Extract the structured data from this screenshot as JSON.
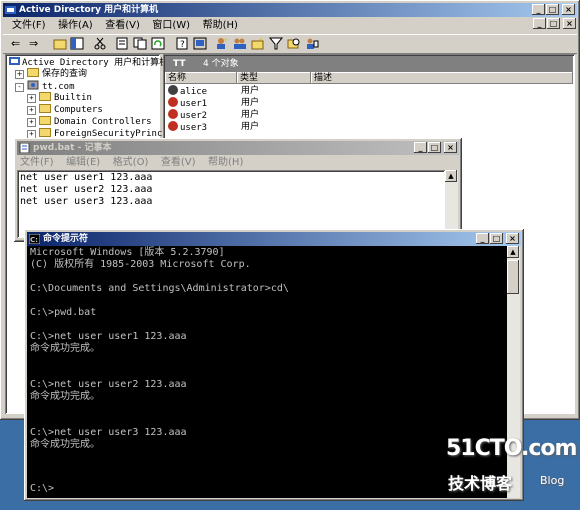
{
  "ad_window": {
    "title": "Active Directory 用户和计算机",
    "menu": [
      "文件(F)",
      "操作(A)",
      "查看(V)",
      "窗口(W)",
      "帮助(H)"
    ],
    "tree": {
      "root": "Active Directory 用户和计算机",
      "saved_queries": "保存的查询",
      "domain": "tt.com",
      "children": [
        "Builtin",
        "Computers",
        "Domain Controllers",
        "ForeignSecurityPrincipa"
      ]
    },
    "list": {
      "container_name": "TT",
      "object_count": "4 个对象",
      "columns": [
        "名称",
        "类型",
        "描述"
      ],
      "rows": [
        {
          "name": "alice",
          "type": "用户",
          "status": "enabled"
        },
        {
          "name": "user1",
          "type": "用户",
          "status": "disabled"
        },
        {
          "name": "user2",
          "type": "用户",
          "status": "disabled"
        },
        {
          "name": "user3",
          "type": "用户",
          "status": "disabled"
        }
      ]
    }
  },
  "notepad": {
    "title": "pwd.bat - 记事本",
    "menu": [
      "文件(F)",
      "编辑(E)",
      "格式(O)",
      "查看(V)",
      "帮助(H)"
    ],
    "lines": [
      "net user user1 123.aaa",
      "net user user2 123.aaa",
      "net user user3 123.aaa"
    ]
  },
  "cmd": {
    "title": "命令提示符",
    "lines": [
      "Microsoft Windows [版本 5.2.3790]",
      "(C) 版权所有 1985-2003 Microsoft Corp.",
      "",
      "C:\\Documents and Settings\\Administrator>cd\\",
      "",
      "C:\\>pwd.bat",
      "",
      "C:\\>net user user1 123.aaa",
      "命令成功完成。",
      "",
      "",
      "C:\\>net user user2 123.aaa",
      "命令成功完成。",
      "",
      "",
      "C:\\>net user user3 123.aaa",
      "命令成功完成。",
      "",
      "",
      "C:\\>"
    ]
  },
  "watermark": {
    "site": "51CTO.com",
    "sub": "技术博客",
    "blog": "Blog"
  },
  "colors": {
    "desktop": "#3a6ea5",
    "title_active": "#0a246a",
    "title_inactive": "#808080",
    "console_bg": "#000000",
    "console_fg": "#c0c0c0"
  }
}
